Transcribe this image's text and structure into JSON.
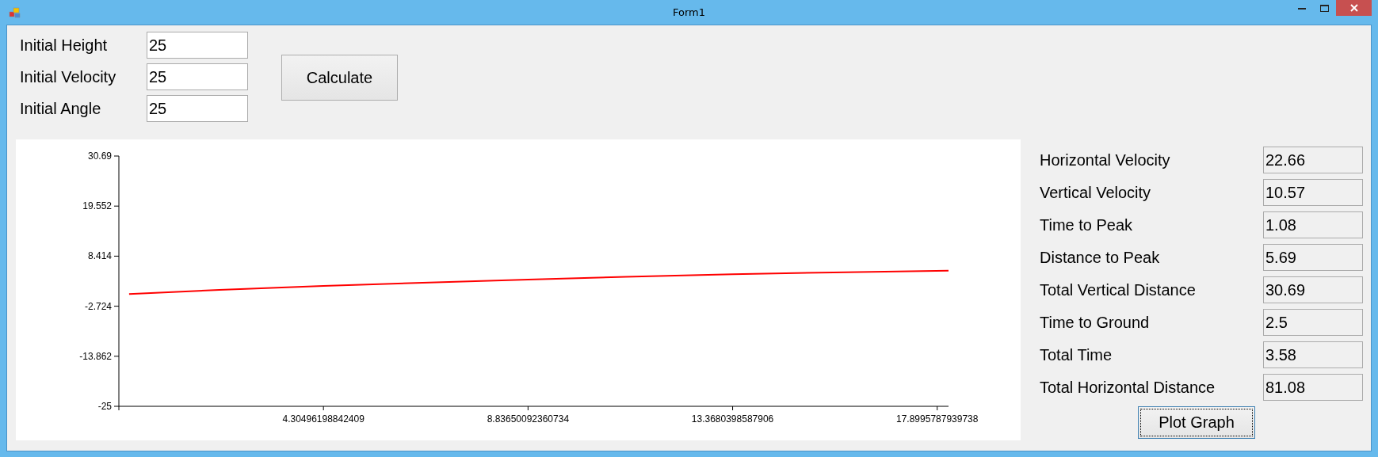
{
  "window": {
    "title": "Form1"
  },
  "inputs": [
    {
      "label": "Initial Height",
      "value": "25"
    },
    {
      "label": "Initial Velocity",
      "value": "25"
    },
    {
      "label": "Initial Angle",
      "value": "25"
    }
  ],
  "calculate_button": "Calculate",
  "chart": {
    "chart_data": {
      "type": "line",
      "x": [
        0,
        2,
        4.305,
        6.5,
        8.8365,
        11,
        13.368,
        15.6,
        18.15
      ],
      "series": [
        {
          "color": "#ff0000",
          "values": [
            0,
            0.9,
            1.8,
            2.5,
            3.2,
            3.8,
            4.4,
            4.8,
            5.2
          ]
        }
      ],
      "xlim": [
        -0.2266,
        18.15
      ],
      "ylim": [
        -25,
        30.69
      ],
      "xticks": [
        {
          "value": 4.30496198842409,
          "label": "4.30496198842409"
        },
        {
          "value": 8.83650092360734,
          "label": "8.83650092360734"
        },
        {
          "value": 13.3680398587906,
          "label": "13.3680398587906"
        },
        {
          "value": 17.8995787939738,
          "label": "17.8995787939738"
        }
      ],
      "yticks": [
        {
          "value": 30.69,
          "label": "30.69"
        },
        {
          "value": 19.552,
          "label": "19.552"
        },
        {
          "value": 8.414,
          "label": "8.414"
        },
        {
          "value": -2.724,
          "label": "-2.724"
        },
        {
          "value": -13.862,
          "label": "-13.862"
        },
        {
          "value": -25,
          "label": "-25"
        }
      ]
    }
  },
  "results": [
    {
      "label": "Horizontal Velocity",
      "value": "22.66"
    },
    {
      "label": "Vertical Velocity",
      "value": "10.57"
    },
    {
      "label": "Time to Peak",
      "value": "1.08"
    },
    {
      "label": "Distance to Peak",
      "value": "5.69"
    },
    {
      "label": "Total Vertical Distance",
      "value": "30.69"
    },
    {
      "label": "Time to Ground",
      "value": "2.5"
    },
    {
      "label": "Total Time",
      "value": "3.58"
    },
    {
      "label": "Total Horizontal Distance",
      "value": "81.08"
    }
  ],
  "plot_button": "Plot Graph"
}
